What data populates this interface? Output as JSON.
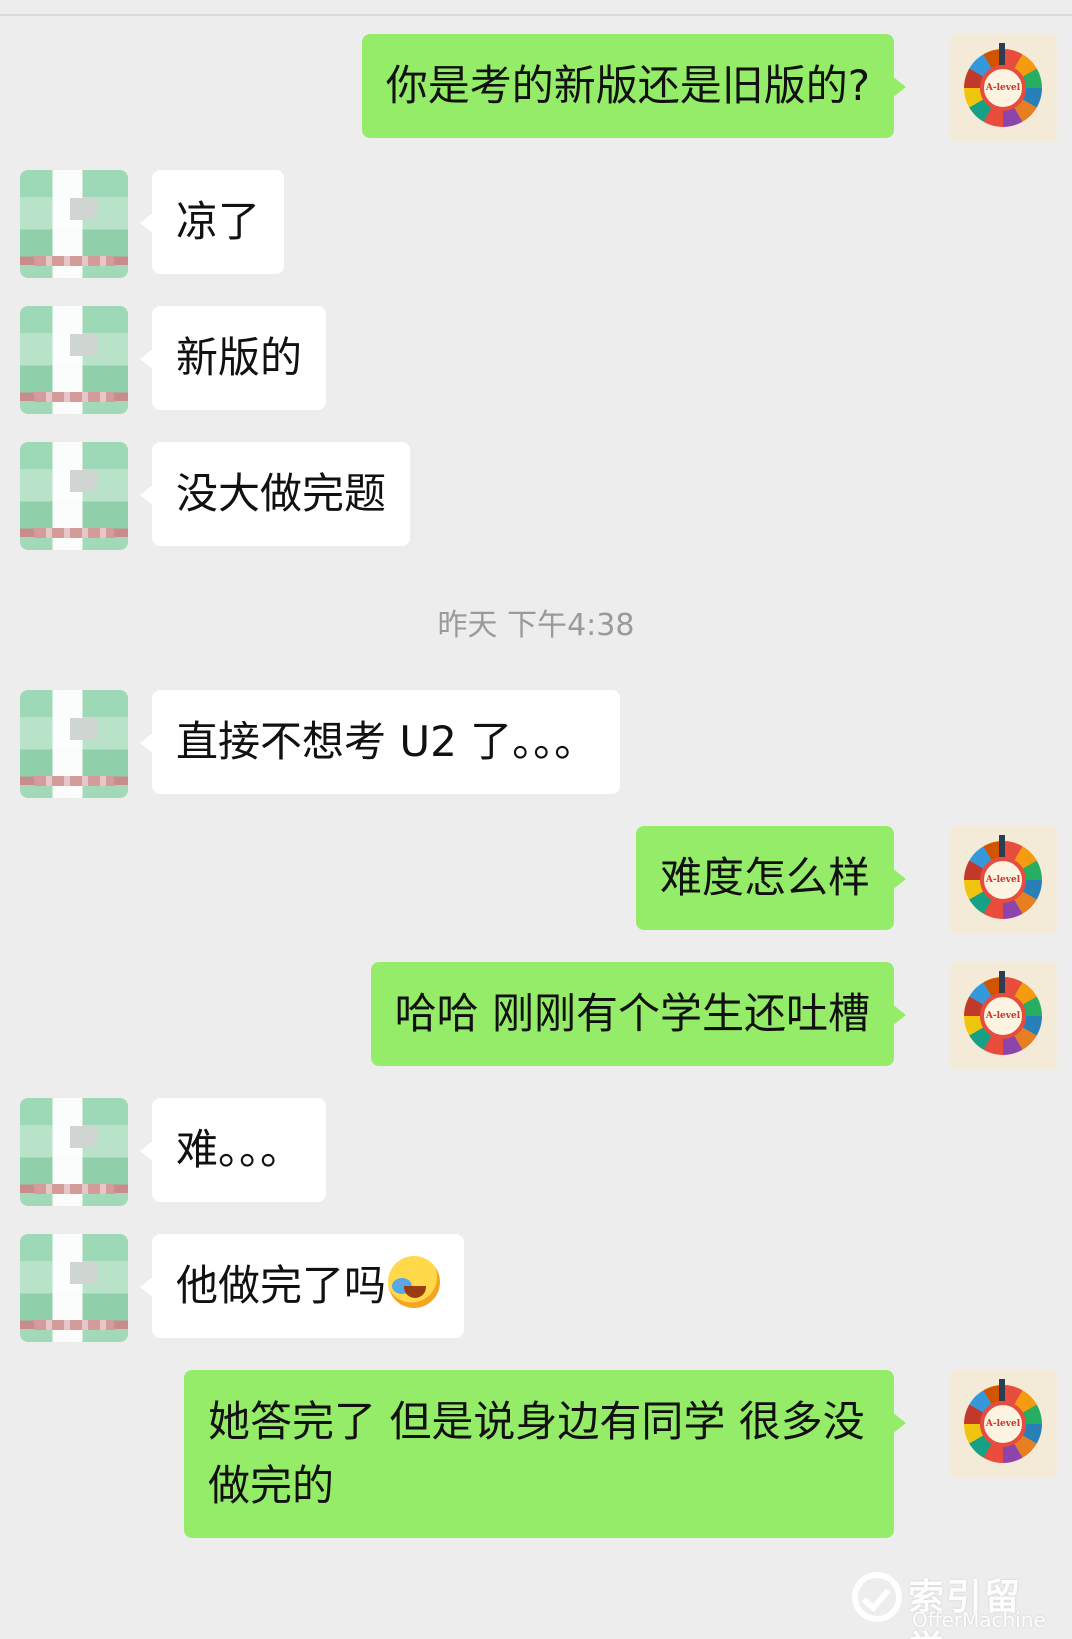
{
  "messages": [
    {
      "from": "me",
      "text": "你是考的新版还是旧版的?"
    },
    {
      "from": "other",
      "text": "凉了"
    },
    {
      "from": "other",
      "text": "新版的"
    },
    {
      "from": "other",
      "text": "没大做完题"
    },
    {
      "timestamp": "昨天 下午4:38"
    },
    {
      "from": "other",
      "text": "直接不想考 U2 了。。。"
    },
    {
      "from": "me",
      "text": "难度怎么样"
    },
    {
      "from": "me",
      "text": "哈哈 刚刚有个学生还吐槽"
    },
    {
      "from": "other",
      "text": "难。。。"
    },
    {
      "from": "other",
      "text": "他做完了吗",
      "emoji": "face-with-tears-of-joy-emoji"
    },
    {
      "from": "me",
      "text": "她答完了  但是说身边有同学 很多没做完的"
    }
  ],
  "my_avatar_label": "A-level",
  "watermark": {
    "title": "索引留学",
    "subtitle": "OfferMachine"
  },
  "colors": {
    "me_bubble": "#95ec69",
    "other_bubble": "#ffffff",
    "background": "#ededed"
  }
}
